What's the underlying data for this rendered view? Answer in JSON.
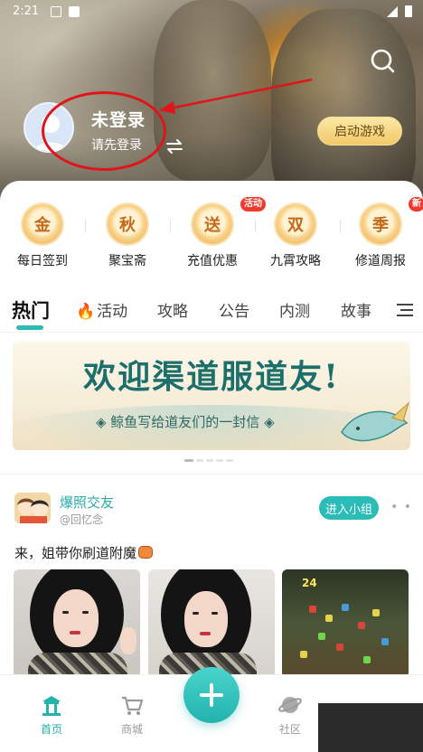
{
  "status_bar": {
    "time": "2:21"
  },
  "header": {
    "login_title": "未登录",
    "login_subtitle": "请先登录",
    "start_game_label": "启动游戏"
  },
  "shortcuts": [
    {
      "glyph": "金",
      "label": "每日签到",
      "tag": ""
    },
    {
      "glyph": "秋",
      "label": "聚宝斋",
      "tag": ""
    },
    {
      "glyph": "送",
      "label": "充值优惠",
      "tag": "活动"
    },
    {
      "glyph": "双",
      "label": "九霄攻略",
      "tag": ""
    },
    {
      "glyph": "季",
      "label": "修道周报",
      "tag": "新"
    }
  ],
  "tabs": [
    "热门",
    "活动",
    "攻略",
    "公告",
    "内测",
    "故事"
  ],
  "active_tab": "热门",
  "banner": {
    "title": "欢迎渠道服道友!",
    "subtitle": "◈ 鲸鱼写给道友们的一封信 ◈"
  },
  "post": {
    "group_name": "爆照交友",
    "handle": "@回忆念",
    "join_label": "进入小组",
    "text": "来，姐带你刷道附魔",
    "game_overlay_number": "24"
  },
  "bottom_nav": [
    {
      "label": "首页",
      "active": true
    },
    {
      "label": "商城",
      "active": false
    },
    {
      "label": "社区",
      "active": false
    }
  ],
  "colors": {
    "accent": "#22b3ad",
    "annotation_red": "#e0141b",
    "start_button": "#f1c868",
    "tag_red": "#ef3a2d"
  }
}
